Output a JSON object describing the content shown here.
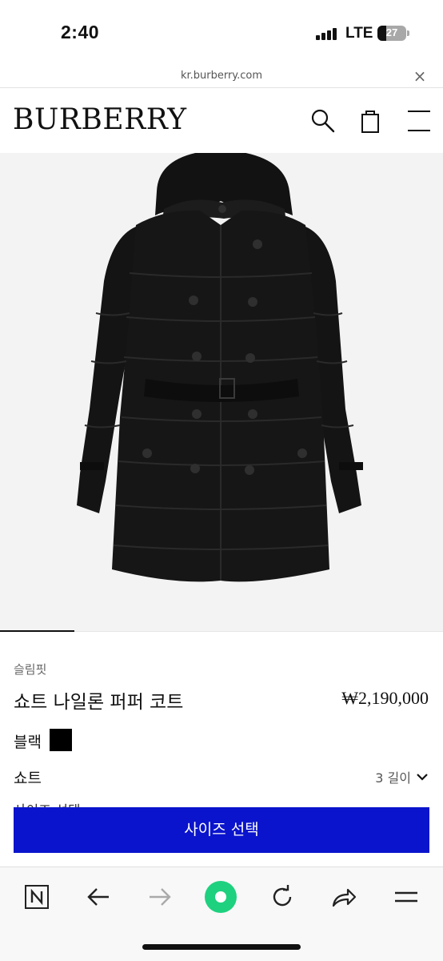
{
  "status_bar": {
    "time": "2:40",
    "network": "LTE",
    "battery": "27"
  },
  "browser": {
    "url": "kr.burberry.com",
    "close_symbol": "×"
  },
  "header": {
    "logo": "BURBERRY",
    "icons": [
      "search-icon",
      "shopping-bag-icon",
      "menu-icon"
    ]
  },
  "product": {
    "image_alt": "black short nylon puffer coat",
    "fit": "슬림핏",
    "name": "쇼트 나일론 퍼퍼 코트",
    "price": "₩2,190,000",
    "color_label": "블랙",
    "color_hex": "#000000",
    "length_label": "쇼트",
    "length_value": "3 길이",
    "size_peek": "사이즈 선택",
    "size_button": "사이즈 선택"
  },
  "theme": {
    "accent": "#0a14cc",
    "reload_indicator": "#1ed17e"
  },
  "toolbar": {
    "buttons": [
      "naver-n-icon",
      "back-arrow-icon",
      "forward-arrow-icon",
      "green-circle-icon",
      "reload-icon",
      "share-icon",
      "menu-lines-icon"
    ]
  }
}
